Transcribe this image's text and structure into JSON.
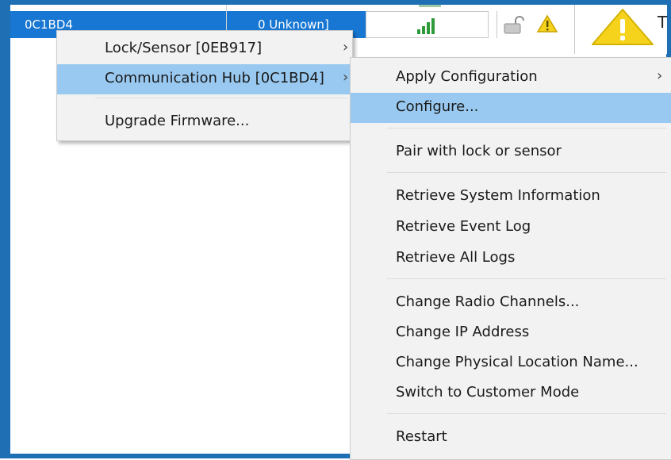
{
  "table": {
    "selected_row": {
      "id": "0C1BD4",
      "status": "0 Unknown]"
    }
  },
  "right_panel": {
    "text": "T"
  },
  "context_menu": {
    "items": [
      {
        "label": "Lock/Sensor [0EB917]",
        "submenu": true
      },
      {
        "label": "Communication Hub [0C1BD4]",
        "submenu": true,
        "highlighted": true
      },
      {
        "label": "Upgrade Firmware...",
        "submenu": false
      }
    ]
  },
  "submenu": {
    "items": [
      {
        "label": "Apply Configuration",
        "submenu": true
      },
      {
        "label": "Configure...",
        "highlighted": true
      },
      {
        "label": "Pair with lock or sensor"
      },
      {
        "label": "Retrieve System Information"
      },
      {
        "label": "Retrieve Event Log"
      },
      {
        "label": "Retrieve All Logs"
      },
      {
        "label": "Change Radio Channels..."
      },
      {
        "label": "Change IP Address"
      },
      {
        "label": "Change Physical Location Name..."
      },
      {
        "label": "Switch to Customer Mode"
      },
      {
        "label": "Restart"
      }
    ]
  },
  "icons": {
    "chevron": "›",
    "signal": "signal-strength-icon",
    "lock": "padlock-icon",
    "warning": "warning-triangle-icon"
  },
  "colors": {
    "frame": "#1f6fb5",
    "selection": "#1877d2",
    "menu_highlight": "#99c9f0",
    "signal_green": "#2e9a3a",
    "warning_yellow": "#f5d21b"
  }
}
